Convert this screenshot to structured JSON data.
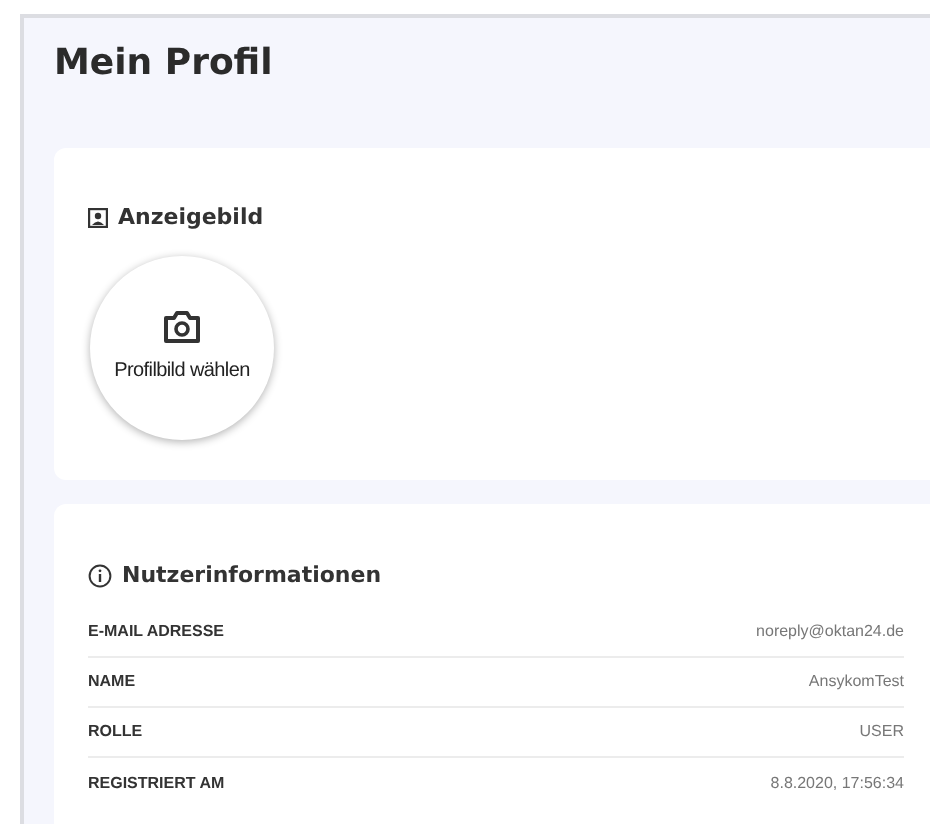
{
  "page_title": "Mein Profil",
  "avatar_section": {
    "title": "Anzeigebild",
    "button": "Profilbild wählen"
  },
  "info_section": {
    "title": "Nutzerinformationen",
    "rows": [
      {
        "label": "E-MAIL ADRESSE",
        "value": "noreply@oktan24.de"
      },
      {
        "label": "NAME",
        "value": "AnsykomTest"
      },
      {
        "label": "ROLLE",
        "value": "USER"
      },
      {
        "label": "REGISTRIERT AM",
        "value": "8.8.2020, 17:56:34"
      }
    ]
  }
}
